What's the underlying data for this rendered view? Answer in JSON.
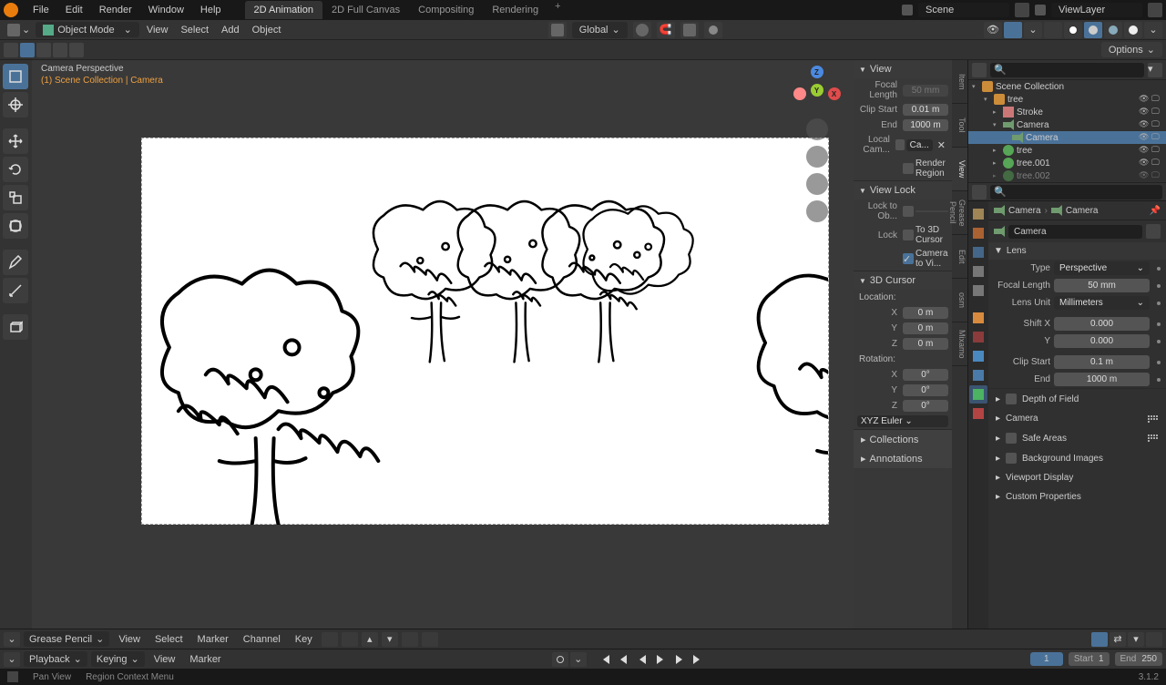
{
  "topmenu": {
    "items": [
      "File",
      "Edit",
      "Render",
      "Window",
      "Help"
    ],
    "tabs": [
      "2D Animation",
      "2D Full Canvas",
      "Compositing",
      "Rendering"
    ],
    "scene_label": "Scene",
    "layer_label": "ViewLayer"
  },
  "header2": {
    "mode": "Object Mode",
    "menus": [
      "View",
      "Select",
      "Add",
      "Object"
    ],
    "orientation": "Global"
  },
  "header3": {
    "options": "Options"
  },
  "viewport": {
    "title": "Camera Perspective",
    "subtitle": "(1) Scene Collection | Camera"
  },
  "npanel": {
    "tabs": [
      "Item",
      "Tool",
      "View",
      "Grease Pencil",
      "Edit",
      "osm",
      "Mixamo"
    ],
    "view": {
      "title": "View",
      "focal_label": "Focal Length",
      "focal": "50 mm",
      "clipstart_label": "Clip Start",
      "clipstart": "0.01 m",
      "end_label": "End",
      "end": "1000 m",
      "localcam_label": "Local Cam...",
      "localcam_value": "Ca...",
      "renderregion": "Render Region"
    },
    "viewlock": {
      "title": "View Lock",
      "lockto_label": "Lock to Ob...",
      "lock_label": "Lock",
      "to3d": "To 3D Cursor",
      "camview": "Camera to Vi..."
    },
    "cursor": {
      "title": "3D Cursor",
      "location": "Location:",
      "rotation": "Rotation:",
      "x": "X",
      "y": "Y",
      "z": "Z",
      "loc_x": "0 m",
      "loc_y": "0 m",
      "loc_z": "0 m",
      "rot_x": "0°",
      "rot_y": "0°",
      "rot_z": "0°",
      "mode": "XYZ Euler"
    },
    "collections": "Collections",
    "annotations": "Annotations"
  },
  "outliner": {
    "root": "Scene Collection",
    "items": [
      {
        "name": "tree",
        "type": "collection",
        "depth": 1,
        "caret": "▾"
      },
      {
        "name": "Stroke",
        "type": "stroke",
        "depth": 2,
        "caret": "▸"
      },
      {
        "name": "Camera",
        "type": "camera",
        "depth": 2,
        "caret": "▾"
      },
      {
        "name": "Camera",
        "type": "camera",
        "depth": 3,
        "selected": true,
        "caret": ""
      },
      {
        "name": "tree",
        "type": "gp",
        "depth": 2,
        "caret": "▸"
      },
      {
        "name": "tree.001",
        "type": "gp",
        "depth": 2,
        "caret": "▸"
      },
      {
        "name": "tree.002",
        "type": "gp",
        "depth": 2,
        "caret": "▸",
        "dim": true
      }
    ]
  },
  "props": {
    "breadcrumb": {
      "a": "Camera",
      "b": "Camera"
    },
    "name": "Camera",
    "lens": {
      "title": "Lens",
      "type_label": "Type",
      "type": "Perspective",
      "focal_label": "Focal Length",
      "focal": "50 mm",
      "unit_label": "Lens Unit",
      "unit": "Millimeters",
      "shiftx_label": "Shift X",
      "shiftx": "0.000",
      "y_label": "Y",
      "shifty": "0.000",
      "clipstart_label": "Clip Start",
      "clipstart": "0.1 m",
      "end_label": "End",
      "end": "1000 m"
    },
    "sections": [
      "Depth of Field",
      "Camera",
      "Safe Areas",
      "Background Images",
      "Viewport Display",
      "Custom Properties"
    ]
  },
  "timeline1": {
    "mode": "Grease Pencil",
    "menus": [
      "View",
      "Select",
      "Marker",
      "Channel",
      "Key"
    ]
  },
  "timeline2": {
    "playback": "Playback",
    "keying": "Keying",
    "menus": [
      "View",
      "Marker"
    ],
    "current_frame": "1",
    "start_label": "Start",
    "start": "1",
    "end_label": "End",
    "end": "250"
  },
  "status": {
    "left": "",
    "pan": "Pan View",
    "context": "Region Context Menu",
    "version": "3.1.2"
  }
}
